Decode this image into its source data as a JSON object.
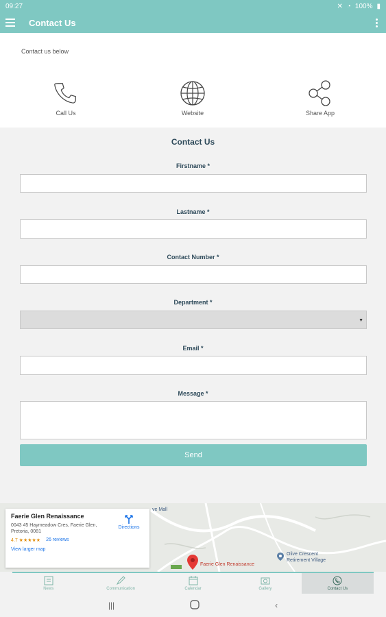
{
  "status_bar": {
    "time": "09:27",
    "battery": "100%"
  },
  "app_bar": {
    "title": "Contact Us"
  },
  "intro_text": "Contact us below",
  "actions": [
    {
      "label": "Call Us",
      "icon": "phone-icon"
    },
    {
      "label": "Website",
      "icon": "globe-icon"
    },
    {
      "label": "Share App",
      "icon": "share-icon"
    }
  ],
  "form": {
    "title": "Contact Us",
    "fields": [
      {
        "label": "Firstname *",
        "value": ""
      },
      {
        "label": "Lastname *",
        "value": ""
      },
      {
        "label": "Contact Number *",
        "value": ""
      },
      {
        "label": "Department *",
        "value": ""
      },
      {
        "label": "Email *",
        "value": ""
      },
      {
        "label": "Message *",
        "value": ""
      }
    ],
    "send_label": "Send"
  },
  "map": {
    "place_name": "Faerie Glen Renaissance",
    "address": "0043 45 Haymeadow Cres, Faerie Glen, Pretoria, 0081",
    "rating": "4.7 ★★★★★",
    "reviews": "26 reviews",
    "directions_label": "Directions",
    "larger_map_label": "View larger map",
    "pin_label": "Faerie Glen Renaissance",
    "poi_label": "Olive Crescent Retirement Village",
    "mall_label": "ve Mall"
  },
  "bottom_nav": [
    {
      "label": "News",
      "icon": "news-icon"
    },
    {
      "label": "Communication",
      "icon": "pen-icon"
    },
    {
      "label": "Calendar",
      "icon": "calendar-icon"
    },
    {
      "label": "Gallery",
      "icon": "gallery-icon"
    },
    {
      "label": "Contact Us",
      "icon": "contact-icon",
      "active": true
    }
  ],
  "colors": {
    "primary": "#7fc8c2",
    "heading": "#2e4a5a"
  }
}
